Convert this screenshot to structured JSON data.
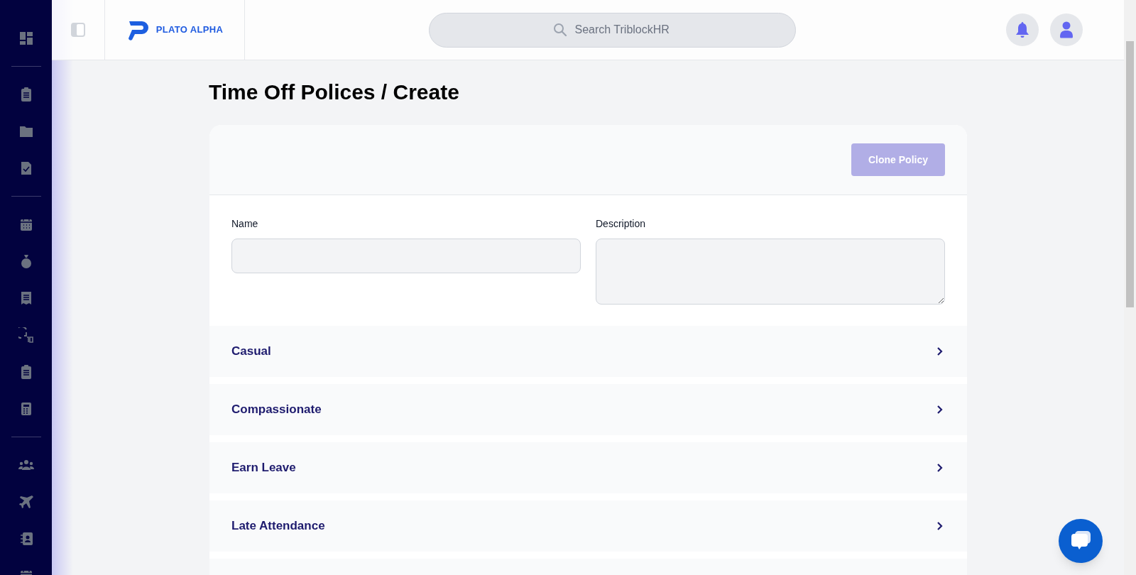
{
  "header": {
    "logo": "PLATO ALPHA",
    "search": {
      "placeholder": "Search TriblockHR"
    }
  },
  "page": {
    "title": "Time Off Polices / Create"
  },
  "form": {
    "clone_button": {
      "label": "Clone Policy",
      "disabled": true
    },
    "fields": [
      {
        "kind": "input",
        "label": "Name"
      },
      {
        "kind": "textarea",
        "label": "Description"
      }
    ]
  },
  "policies": [
    {
      "label": "Casual",
      "expanded": false
    },
    {
      "label": "Compassionate",
      "expanded": false
    },
    {
      "label": "Earn Leave",
      "expanded": false
    },
    {
      "label": "Late Attendance",
      "expanded": false
    }
  ]
}
